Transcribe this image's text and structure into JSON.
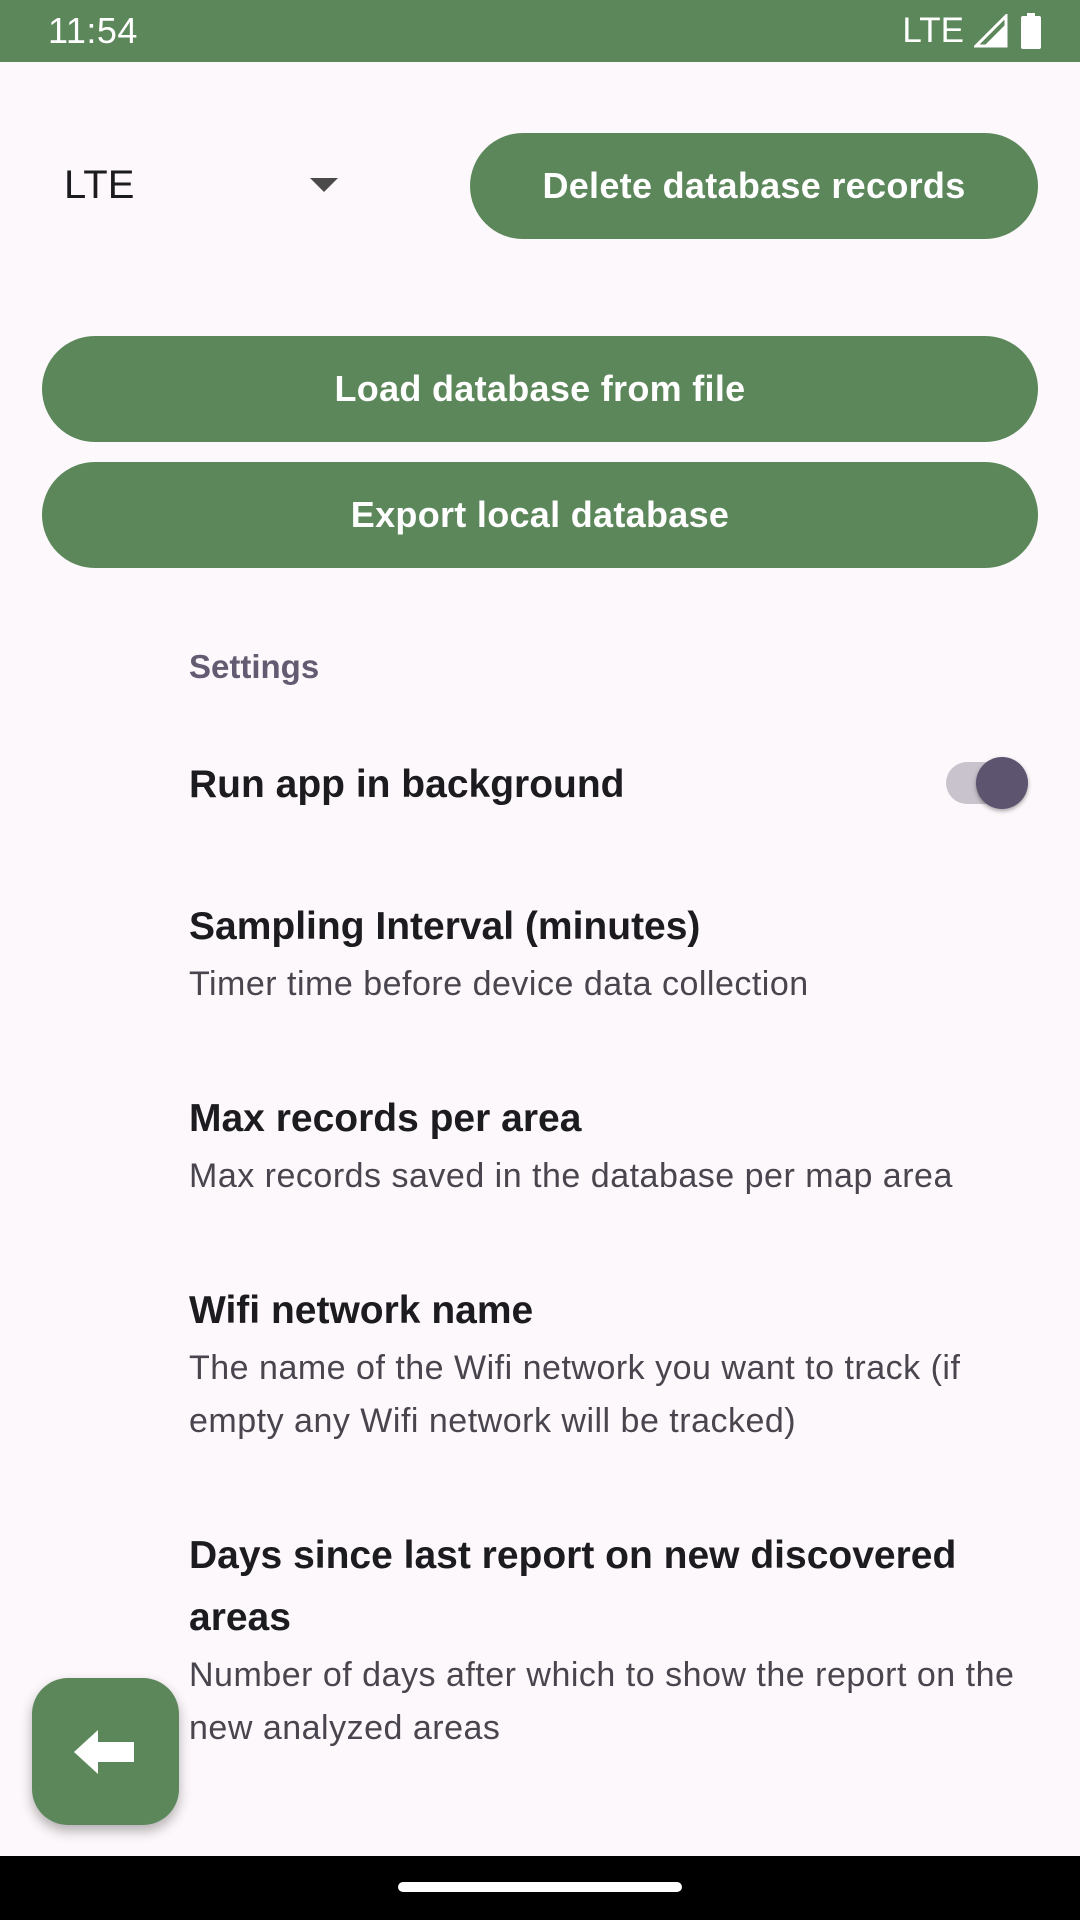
{
  "status_bar": {
    "time": "11:54",
    "network": "LTE",
    "signal_icon": "signal-icon",
    "battery_icon": "battery-icon",
    "background_color": "#5c875b"
  },
  "spinner": {
    "selected": "LTE",
    "icon": "dropdown-arrow-icon"
  },
  "buttons": {
    "delete": "Delete database records",
    "load": "Load database from file",
    "export": "Export local database",
    "color": "#5c875b"
  },
  "settings": {
    "section_title": "Settings",
    "run_in_background": {
      "title": "Run app in background",
      "enabled": true
    },
    "sampling_interval": {
      "title": "Sampling Interval (minutes)",
      "summary": "Timer time before device data collection"
    },
    "max_records": {
      "title": "Max records per area",
      "summary": "Max records saved in the database per map area"
    },
    "wifi_name": {
      "title": "Wifi network name",
      "summary": "The name of the Wifi network you want to track (if empty any Wifi network will be tracked)"
    },
    "days_since_report": {
      "title": "Days since last report on new discovered areas",
      "summary": "Number of days after which to show the report on the new analyzed areas"
    }
  },
  "fab": {
    "icon": "back-arrow-icon"
  }
}
